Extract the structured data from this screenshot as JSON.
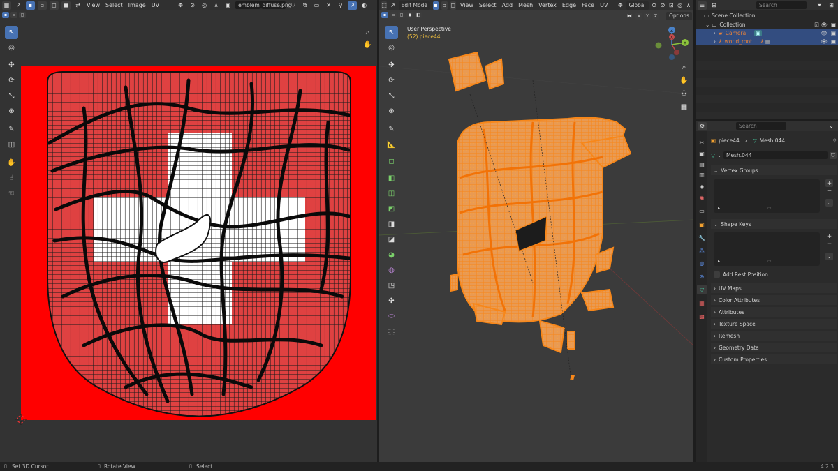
{
  "uv_editor": {
    "menus": [
      "View",
      "Select",
      "Image",
      "UV"
    ],
    "image_name": "emblem_diffuse.png"
  },
  "viewport": {
    "mode": "Edit Mode",
    "menus": [
      "View",
      "Select",
      "Add",
      "Mesh",
      "Vertex",
      "Edge",
      "Face",
      "UV"
    ],
    "orientation": "Global",
    "options_label": "Options",
    "perspective_label": "User Perspective",
    "object_label": "(52) piece44",
    "axes": {
      "x": "X",
      "y": "Y",
      "z": "Z"
    },
    "mirror_axes": [
      "X",
      "Y",
      "Z"
    ],
    "colors": {
      "mesh": "#f28a1c",
      "axis_x": "#c44c4c",
      "axis_y": "#8cc43c",
      "axis_z": "#4a82c8"
    }
  },
  "outliner": {
    "search_placeholder": "Search",
    "scene_collection": "Scene Collection",
    "collection": "Collection",
    "items": [
      {
        "label": "Camera",
        "color": "#e8823a"
      },
      {
        "label": "world_root",
        "color": "#e8823a"
      }
    ]
  },
  "properties": {
    "search_placeholder": "Search",
    "object_name": "piece44",
    "mesh_name": "Mesh.044",
    "data_name": "Mesh.044",
    "vertex_groups": "Vertex Groups",
    "shape_keys": "Shape Keys",
    "add_rest_position": "Add Rest Position",
    "sections": [
      "UV Maps",
      "Color Attributes",
      "Attributes",
      "Texture Space",
      "Remesh",
      "Geometry Data",
      "Custom Properties"
    ]
  },
  "status_bar": {
    "items": [
      "Set 3D Cursor",
      "Rotate View",
      "Select"
    ],
    "version": "4.2.3"
  }
}
